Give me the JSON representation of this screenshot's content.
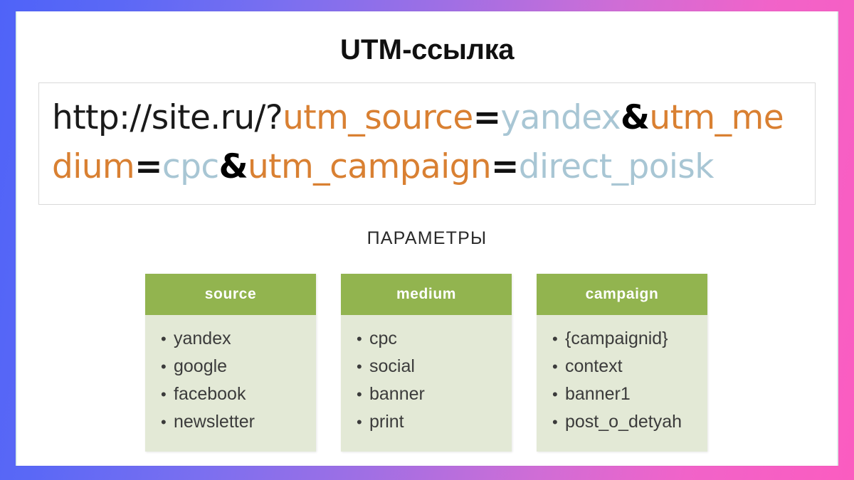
{
  "slide": {
    "title_strong": "UTM",
    "title_rest": "-ссылка",
    "params_label": "ПАРАМЕТРЫ"
  },
  "url": {
    "full": "http://site.ru/?utm_source=yandex&utm_medium=cpc&utm_campaign=direct_poisk",
    "tokens": [
      {
        "text": "http://site.ru/?",
        "kind": "base"
      },
      {
        "text": "utm_source",
        "kind": "key"
      },
      {
        "text": "=",
        "kind": "eq"
      },
      {
        "text": "yandex",
        "kind": "val"
      },
      {
        "text": "&",
        "kind": "amp"
      },
      {
        "text": "utm_medium",
        "kind": "key"
      },
      {
        "text": "=",
        "kind": "eq"
      },
      {
        "text": "cpc",
        "kind": "val"
      },
      {
        "text": "&",
        "kind": "amp"
      },
      {
        "text": "utm_campaign",
        "kind": "key"
      },
      {
        "text": "=",
        "kind": "eq"
      },
      {
        "text": "direct_poisk",
        "kind": "val"
      }
    ]
  },
  "cards": [
    {
      "header": "source",
      "items": [
        "yandex",
        "google",
        "facebook",
        "newsletter"
      ]
    },
    {
      "header": "medium",
      "items": [
        "cpc",
        "social",
        "banner",
        "print"
      ]
    },
    {
      "header": "campaign",
      "items": [
        "{campaignid}",
        "context",
        "banner1",
        "post_o_detyah"
      ]
    }
  ],
  "colors": {
    "card_header_green": "#92b44f",
    "card_body_green": "#e3e9d6",
    "utm_key_orange": "#d98032",
    "utm_value_blue": "#a8c6d4",
    "background_start": "#4f63f8",
    "background_end": "#fb5cc0",
    "bullet_text": "#3b3b3b"
  },
  "bullet_glyph": "•"
}
